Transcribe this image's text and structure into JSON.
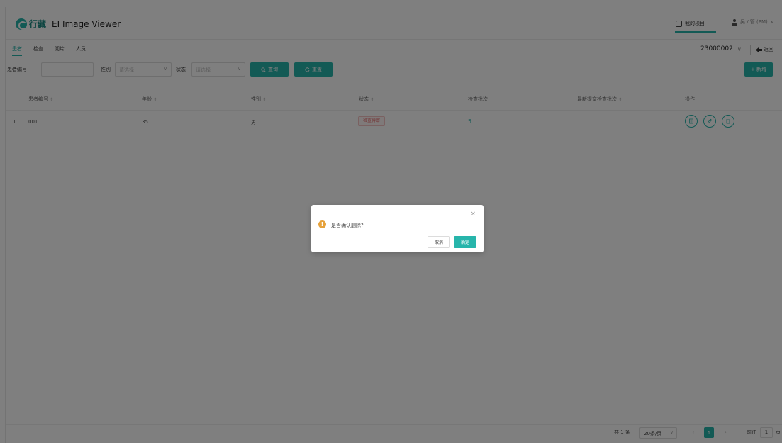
{
  "header": {
    "logo_text": "行藏",
    "app_title": "EI Image Viewer",
    "my_projects": "我的项目",
    "user": "吴 / 管 (PM)",
    "user_chevron": "∨"
  },
  "tabs": [
    {
      "label": "患者",
      "active": true
    },
    {
      "label": "检查",
      "active": false
    },
    {
      "label": "阅片",
      "active": false
    },
    {
      "label": "人员",
      "active": false
    }
  ],
  "project_select": {
    "value": "23000002",
    "chevron": "∨"
  },
  "back_label": "返回",
  "filters": {
    "patient_id_label": "患者编号",
    "gender_label": "性别",
    "gender_placeholder": "请选择",
    "status_label": "状态",
    "status_placeholder": "请选择",
    "search_label": "查询",
    "reset_label": "重置",
    "add_label": "+ 新增"
  },
  "table": {
    "columns": [
      "患者编号",
      "年龄",
      "性别",
      "状态",
      "检查批次",
      "最新提交检查批次",
      "操作"
    ],
    "sort_glyph": "⇕",
    "rows": [
      {
        "index": "1",
        "patient_id": "001",
        "age": "35",
        "gender": "男",
        "status": "检查待审",
        "batch_count": "5",
        "latest_batch": ""
      }
    ]
  },
  "pagination": {
    "total": "共 1 条",
    "page_size": "20条/页",
    "page_size_chevron": "∨",
    "prev": "‹",
    "current_page": "1",
    "next": "›",
    "goto_label": "前往",
    "goto_value": "1",
    "page_suffix": "页"
  },
  "dialog": {
    "message": "是否确认删除?",
    "warning_glyph": "!",
    "close_glyph": "×",
    "cancel_label": "取消",
    "confirm_label": "确定"
  },
  "colors": {
    "accent": "#27b5ab",
    "warning": "#e6a23c",
    "danger_tag": "#e45c5c"
  }
}
